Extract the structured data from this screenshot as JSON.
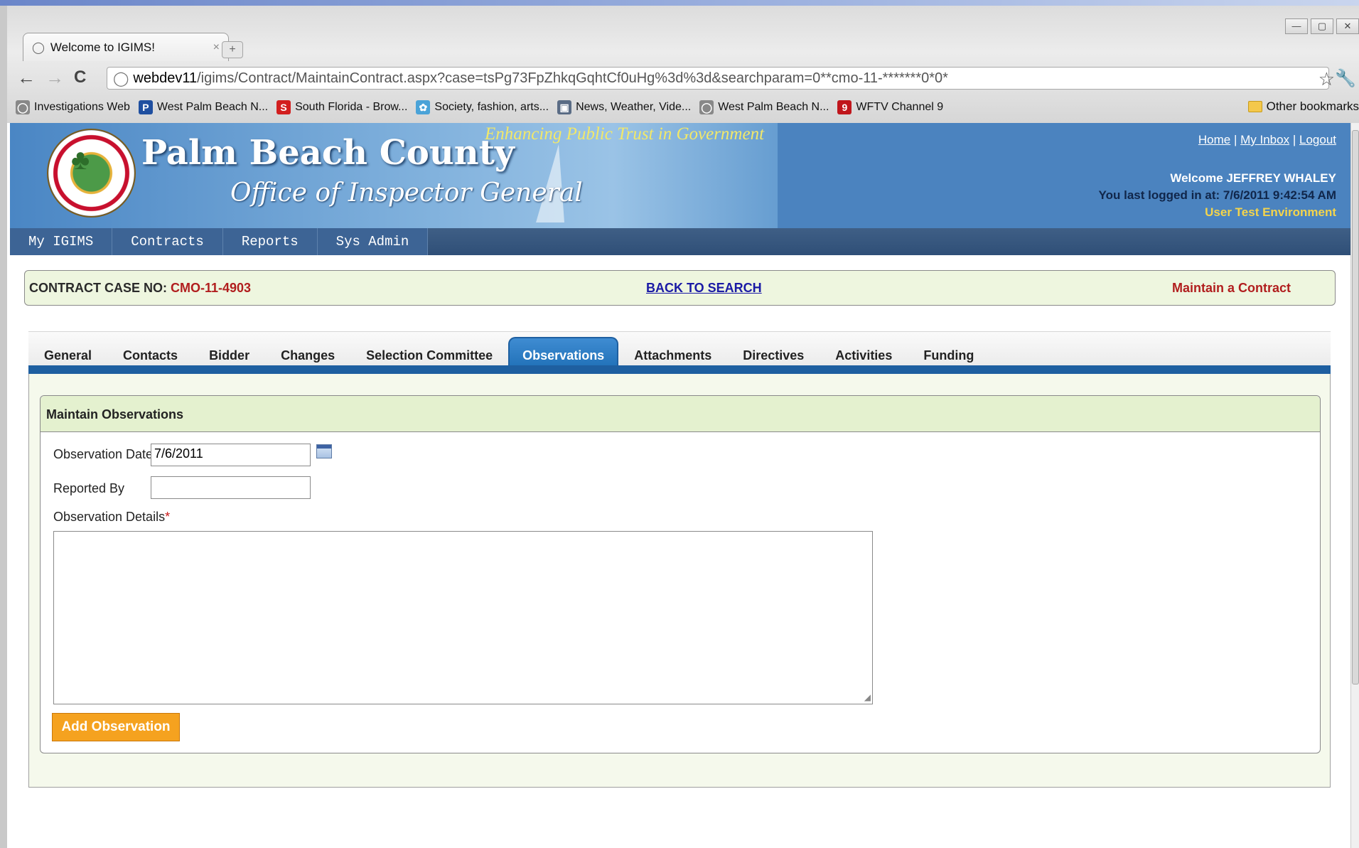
{
  "browser": {
    "tab_title": "Welcome to IGIMS!",
    "tab_close": "×",
    "new_tab": "+",
    "url_host": "webdev11",
    "url_path": "/igims/Contract/MaintainContract.aspx?case=tsPg73FpZhkqGqhtCf0uHg%3d%3d&searchparam=0**cmo-11-*******0*0*",
    "back_icon": "←",
    "forward_icon": "→",
    "reload_icon": "C",
    "star_icon": "☆",
    "wrench_icon": "🔧",
    "window_controls": [
      "—",
      "▢",
      "✕"
    ],
    "bookmarks": [
      {
        "label": "Investigations Web",
        "icon": "globe-icon",
        "color": "#888888",
        "glyph": "◯"
      },
      {
        "label": "West Palm Beach N...",
        "icon": "palm-beach-post-icon",
        "color": "#1f4fa0",
        "glyph": "P"
      },
      {
        "label": "South Florida - Brow...",
        "icon": "sun-sentinel-icon",
        "color": "#d21f1f",
        "glyph": "S"
      },
      {
        "label": "Society, fashion, arts...",
        "icon": "society-icon",
        "color": "#4aa3d8",
        "glyph": "✿"
      },
      {
        "label": "News, Weather, Vide...",
        "icon": "news-icon",
        "color": "#5a6c85",
        "glyph": "▣"
      },
      {
        "label": "West Palm Beach N...",
        "icon": "globe-icon",
        "color": "#888888",
        "glyph": "◯"
      },
      {
        "label": "WFTV Channel 9",
        "icon": "wftv-icon",
        "color": "#c0161c",
        "glyph": "9"
      }
    ],
    "other_bookmarks": "Other bookmarks"
  },
  "banner": {
    "title": "Palm Beach County",
    "subtitle": "Office of Inspector General",
    "tagline": "Enhancing Public Trust in Government",
    "links": {
      "home": "Home",
      "inbox": "My Inbox",
      "logout": "Logout",
      "sep": "|"
    },
    "welcome": "Welcome JEFFREY WHALEY",
    "last_login": "You last logged in at: 7/6/2011 9:42:54 AM",
    "environment": "User Test Environment"
  },
  "menu": [
    "My IGIMS",
    "Contracts",
    "Reports",
    "Sys Admin"
  ],
  "case": {
    "label": "CONTRACT CASE NO: ",
    "number": "CMO-11-4903",
    "back_link": "BACK TO SEARCH",
    "page_title": "Maintain a Contract"
  },
  "tabs": [
    "General",
    "Contacts",
    "Bidder",
    "Changes",
    "Selection Committee",
    "Observations",
    "Attachments",
    "Directives",
    "Activities",
    "Funding"
  ],
  "active_tab": "Observations",
  "form": {
    "header": "Maintain Observations",
    "date_label": "Observation Date",
    "date_value": "7/6/2011",
    "reported_by_label": "Reported By",
    "reported_by_value": "",
    "details_label": "Observation Details",
    "required_mark": "*",
    "details_value": "",
    "submit_label": "Add Observation"
  },
  "colors": {
    "accent": "#1e5fa0",
    "case_number": "#b11e1e",
    "button": "#f5a21f",
    "env_text": "#f3d44c"
  }
}
